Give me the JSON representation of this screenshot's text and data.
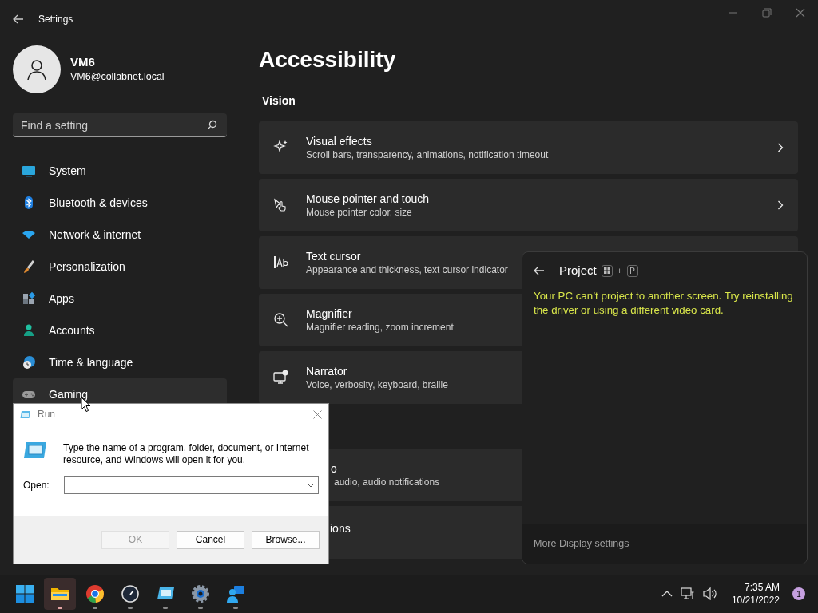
{
  "window": {
    "title": "Settings"
  },
  "account": {
    "name": "VM6",
    "email": "VM6@collabnet.local"
  },
  "search": {
    "placeholder": "Find a setting"
  },
  "sidebar": {
    "items": [
      {
        "label": "System",
        "hovered": false
      },
      {
        "label": "Bluetooth & devices",
        "hovered": false
      },
      {
        "label": "Network & internet",
        "hovered": false
      },
      {
        "label": "Personalization",
        "hovered": false
      },
      {
        "label": "Apps",
        "hovered": false
      },
      {
        "label": "Accounts",
        "hovered": false
      },
      {
        "label": "Time & language",
        "hovered": false
      },
      {
        "label": "Gaming",
        "hovered": true
      }
    ]
  },
  "page": {
    "title": "Accessibility",
    "section": "Vision",
    "cards": [
      {
        "title": "Visual effects",
        "subtitle": "Scroll bars, transparency, animations, notification timeout",
        "chevron": true
      },
      {
        "title": "Mouse pointer and touch",
        "subtitle": "Mouse pointer color, size",
        "chevron": true
      },
      {
        "title": "Text cursor",
        "subtitle": "Appearance and thickness, text cursor indicator"
      },
      {
        "title": "Magnifier",
        "subtitle": "Magnifier reading, zoom increment"
      },
      {
        "title": "Narrator",
        "subtitle": "Voice, verbosity, keyboard, braille"
      },
      {
        "title": "o",
        "subtitle": "audio, audio notifications",
        "kind": "partial"
      },
      {
        "title": "ions",
        "kind": "partial"
      }
    ]
  },
  "run_dialog": {
    "title": "Run",
    "message": "Type the name of a program, folder, document, or Internet resource, and Windows will open it for you.",
    "open_label": "Open:",
    "buttons": [
      {
        "label": "OK",
        "disabled": true
      },
      {
        "label": "Cancel",
        "disabled": false
      },
      {
        "label": "Browse...",
        "disabled": false
      }
    ]
  },
  "project_panel": {
    "title": "Project",
    "shortcut_plus": "+",
    "shortcut_key": "P",
    "message": "Your PC can’t project to another screen. Try reinstalling the driver or using a different video card.",
    "footer": "More Display settings"
  },
  "taskbar": {
    "apps": [
      {
        "selected": true
      },
      {
        "selected": false
      },
      {
        "selected": false
      },
      {
        "selected": false
      },
      {
        "selected": false
      },
      {
        "selected": false
      }
    ],
    "time": "7:35 AM",
    "date": "10/21/2022",
    "notification_count": "1"
  }
}
